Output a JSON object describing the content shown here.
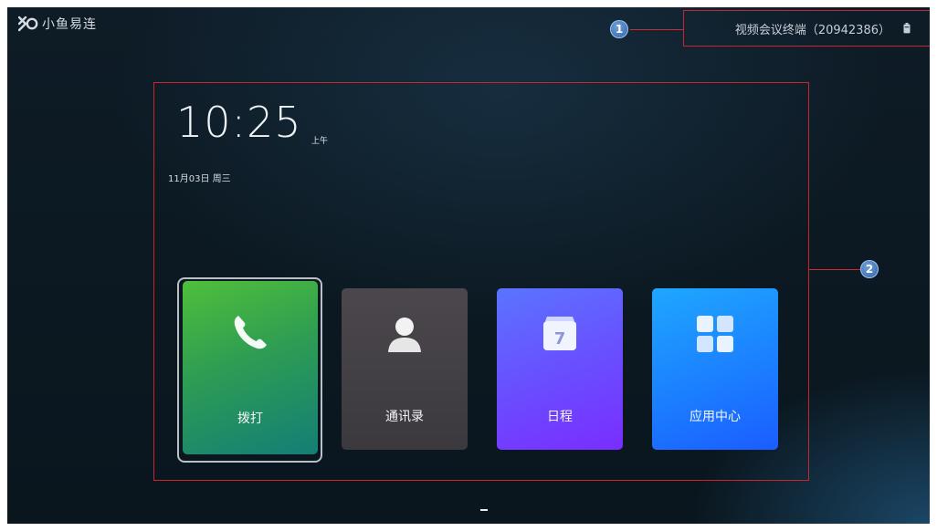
{
  "app": {
    "logo_text": "小鱼易连"
  },
  "header": {
    "device_label": "视频会议终端（20942386）",
    "callout_1": "1"
  },
  "callout_2": "2",
  "clock": {
    "time": "10:25",
    "ampm": "上午",
    "date": "11月03日 周三"
  },
  "tiles": [
    {
      "label": "拨打",
      "icon": "phone-icon"
    },
    {
      "label": "通讯录",
      "icon": "contact-icon"
    },
    {
      "label": "日程",
      "icon": "calendar-icon",
      "icon_number": "7"
    },
    {
      "label": "应用中心",
      "icon": "apps-grid-icon"
    }
  ],
  "colors": {
    "annotation_red": "#c8252d",
    "dial_green": "#2e9d53",
    "schedule_purple": "#6a4cff",
    "apps_blue": "#1b7cff"
  }
}
